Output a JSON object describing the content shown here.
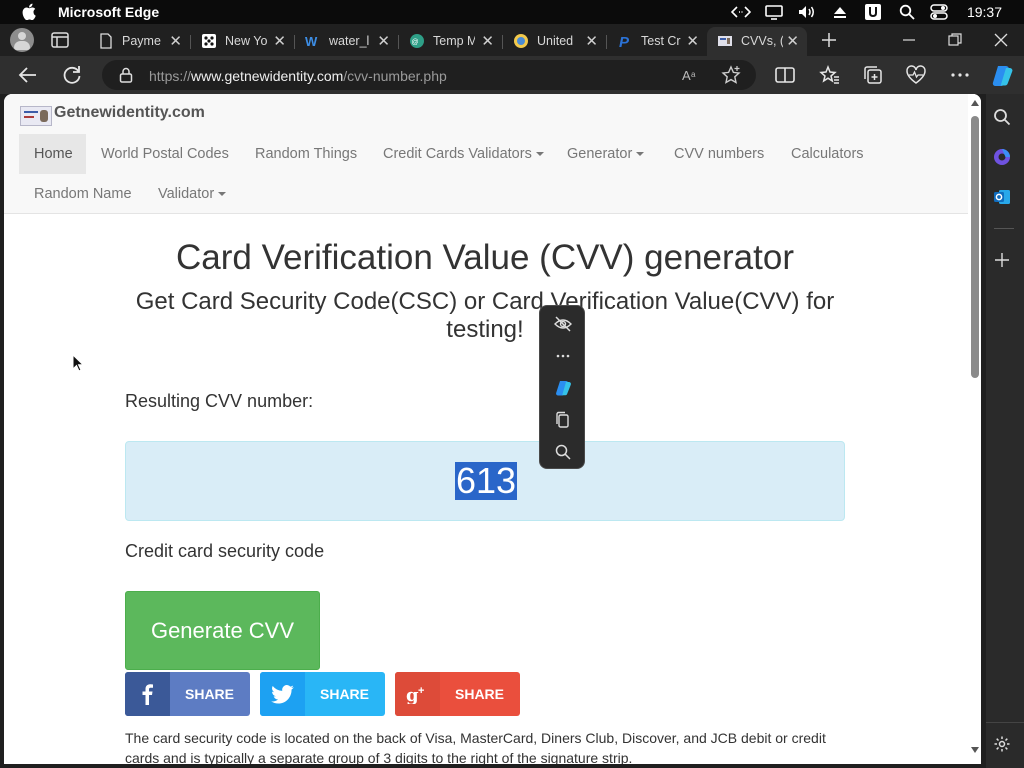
{
  "menubar": {
    "app_name": "Microsoft Edge",
    "clock": "19:37"
  },
  "tabs": [
    {
      "title": "Payme",
      "icon": "document-icon"
    },
    {
      "title": "New Yo",
      "icon": "dice-icon"
    },
    {
      "title": "water_l",
      "icon": "w-logo-icon"
    },
    {
      "title": "Temp M",
      "icon": "temp-mail-icon"
    },
    {
      "title": "United",
      "icon": "globe-icon"
    },
    {
      "title": "Test Cr",
      "icon": "paypal-icon"
    },
    {
      "title": "CVVs, (",
      "icon": "site-favicon",
      "active": true
    }
  ],
  "address": {
    "url_prefix": "https://",
    "url_domain": "www.getnewidentity.com",
    "url_path": "/cvv-number.php"
  },
  "site": {
    "brand": "Getnewidentity.com",
    "nav": [
      {
        "label": "Home"
      },
      {
        "label": "World Postal Codes"
      },
      {
        "label": "Random Things"
      },
      {
        "label": "Credit Cards Validators"
      },
      {
        "label": "Generator"
      },
      {
        "label": "CVV numbers"
      },
      {
        "label": "Calculators"
      },
      {
        "label": "Random Name"
      },
      {
        "label": "Validator"
      }
    ]
  },
  "main": {
    "title": "Card Verification Value (CVV) generator",
    "subtitle": "Get Card Security Code(CSC) or Card Verification Value(CVV) for testing!",
    "result_label": "Resulting CVV number:",
    "cvv_value": "613",
    "security_label": "Credit card security code",
    "generate_label": "Generate CVV",
    "share": [
      {
        "label": "SHARE",
        "network": "facebook",
        "color": "#5d7cc3"
      },
      {
        "label": "SHARE",
        "network": "twitter",
        "color": "#29b6f6"
      },
      {
        "label": "SHARE",
        "network": "google-plus",
        "color": "#ea4f3d"
      }
    ],
    "description": "The card security code is located on the back of Visa, MasterCard, Diners Club, Discover, and JCB debit or credit cards and is typically a separate group of 3 digits to the right of the signature strip."
  },
  "colors": {
    "result_bg": "#d9edf7",
    "generate_bg": "#5cb85c",
    "selection": "#2a66c9"
  }
}
